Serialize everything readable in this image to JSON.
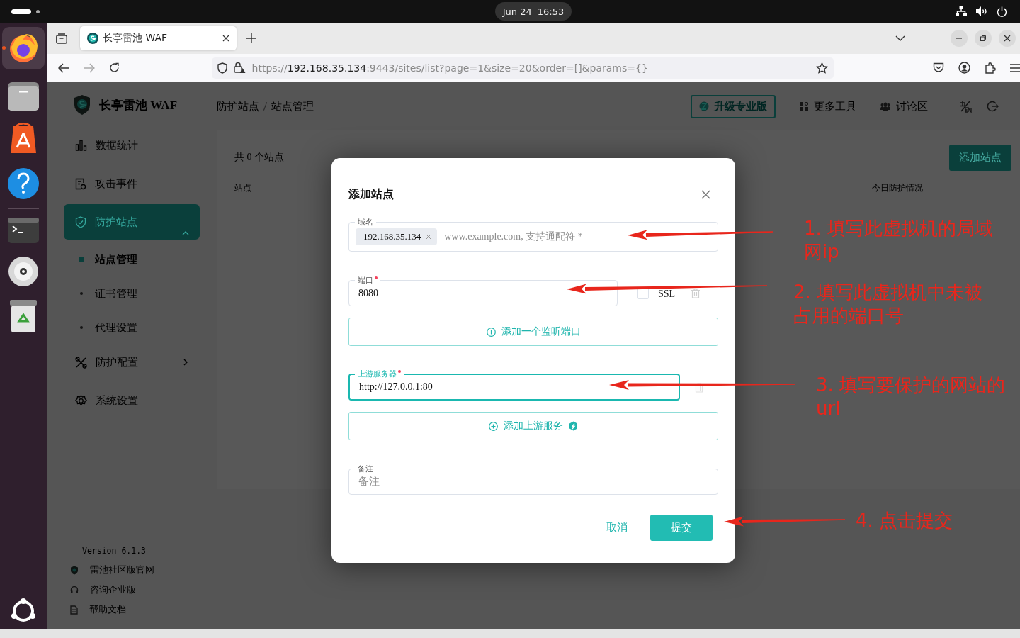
{
  "top_bar": {
    "date": "Jun 24",
    "time": "16:53"
  },
  "browser": {
    "tab": {
      "title": "长亭雷池 WAF"
    },
    "url": {
      "scheme": "https://",
      "host": "192.168.35.134",
      "rest": ":9443/sites/list?page=1&size=20&order=[]&params={}"
    }
  },
  "app": {
    "brand": "长亭雷池 WAF",
    "breadcrumb": [
      "防护站点",
      "站点管理"
    ],
    "header_tools": [
      {
        "label": "升级专业版",
        "kind": "upgrade"
      },
      {
        "label": "更多工具",
        "kind": "tools"
      },
      {
        "label": "讨论区",
        "kind": "forum"
      }
    ],
    "sidebar": {
      "items": [
        {
          "label": "数据统计",
          "selected": false
        },
        {
          "label": "攻击事件",
          "selected": false
        },
        {
          "label": "防护站点",
          "selected": true,
          "expanded": true,
          "children": [
            {
              "label": "站点管理",
              "selected": true
            },
            {
              "label": "证书管理",
              "selected": false
            },
            {
              "label": "代理设置",
              "selected": false
            }
          ]
        },
        {
          "label": "防护配置",
          "selected": false,
          "expanded": false
        },
        {
          "label": "系统设置",
          "selected": false
        }
      ],
      "version": "Version 6.1.3",
      "links": [
        "雷池社区版官网",
        "咨询企业版",
        "帮助文档"
      ]
    },
    "content": {
      "count": "共 0 个站点",
      "add_button": "添加站点",
      "columns": [
        "站点",
        "今日防护情况"
      ]
    }
  },
  "dialog": {
    "title": "添加站点",
    "domain": {
      "label": "域名",
      "tags": [
        "192.168.35.134"
      ],
      "placeholder": "www.example.com, 支持通配符 *"
    },
    "port": {
      "label": "端口",
      "required": true,
      "value": "8080",
      "ssl_label": "SSL",
      "ssl_checked": false
    },
    "add_port": "添加一个监听端口",
    "upstream": {
      "label": "上游服务器",
      "required": true,
      "value": "http://127.0.0.1:80",
      "focused": true
    },
    "add_upstream": "添加上游服务",
    "remark": {
      "label": "备注",
      "placeholder": "备注"
    },
    "cancel": "取消",
    "submit": "提交"
  },
  "annotations": [
    {
      "text": "1. 填写此虚拟机的局域网ip"
    },
    {
      "text": "2. 填写此虚拟机中未被占用的端口号"
    },
    {
      "text": "3. 填写要保护的网站的url"
    },
    {
      "text": "4. 点击提交"
    }
  ]
}
